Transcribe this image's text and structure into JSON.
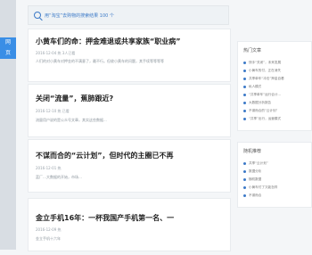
{
  "logo_text": [
    "网",
    "页"
  ],
  "search_banner": "用“淘宝”去购物的搜索结果 100 个",
  "cards": [
    {
      "title": "小黄车们的命：押金难退或共享家族“职业病”",
      "meta": "2016-12-04 热 3人已看",
      "excerpt": "人们的对小黄车对押金的不满意了，最不行。但收小黄车的问题，其手续等等等等"
    },
    {
      "title": "关闭“流量”，蕉肺跟近?",
      "meta": "2016-12-10 热 已看",
      "excerpt": "流量用户说的是公众号文章，其实这些数据..."
    },
    {
      "title": "不谋而合的“云计划”，但时代的主圈已不再",
      "meta": "2016-12-01 热",
      "excerpt": "蓝厂…大数据的开始，市场…"
    },
    {
      "title": "金立手机16年：一杯我国产手机第一名、一",
      "meta": "2016-12-09 热",
      "excerpt": "金立手机十六年"
    }
  ],
  "sidebar": {
    "widget1": {
      "title": "热门文章",
      "items": [
        "快手“关闭”，未来发展",
        "小黄车的付，正在消失",
        "共享单车“冲击”押金自看",
        "私人模式",
        "“共享单车”运行合计...",
        "大数据分析报告",
        "不谋而合的“云计划”",
        "“共享”出行，运营模式"
      ]
    },
    "widget2": {
      "title": "随机推荐",
      "items": [
        "共享“云计划”",
        "数据分析",
        "随机数据",
        "小黄车付了又能怎样",
        "不谋而合"
      ]
    }
  }
}
